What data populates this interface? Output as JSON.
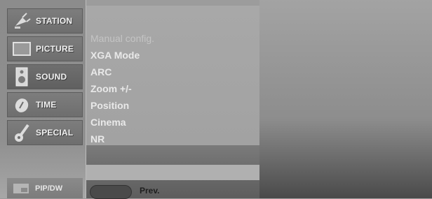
{
  "sidebar": {
    "items": [
      {
        "label": "STATION",
        "icon": "satellite-icon"
      },
      {
        "label": "PICTURE",
        "icon": "picture-icon"
      },
      {
        "label": "SOUND",
        "icon": "speaker-icon"
      },
      {
        "label": "TIME",
        "icon": "clock-icon"
      },
      {
        "label": "SPECIAL",
        "icon": "key-icon"
      }
    ],
    "pip_label": "PIP/DW"
  },
  "menu": {
    "items": [
      "Manual config.",
      "XGA Mode",
      "ARC",
      "Zoom +/-",
      "Position",
      "Cinema",
      "NR"
    ]
  },
  "footer": {
    "prev_label": "Prev."
  }
}
